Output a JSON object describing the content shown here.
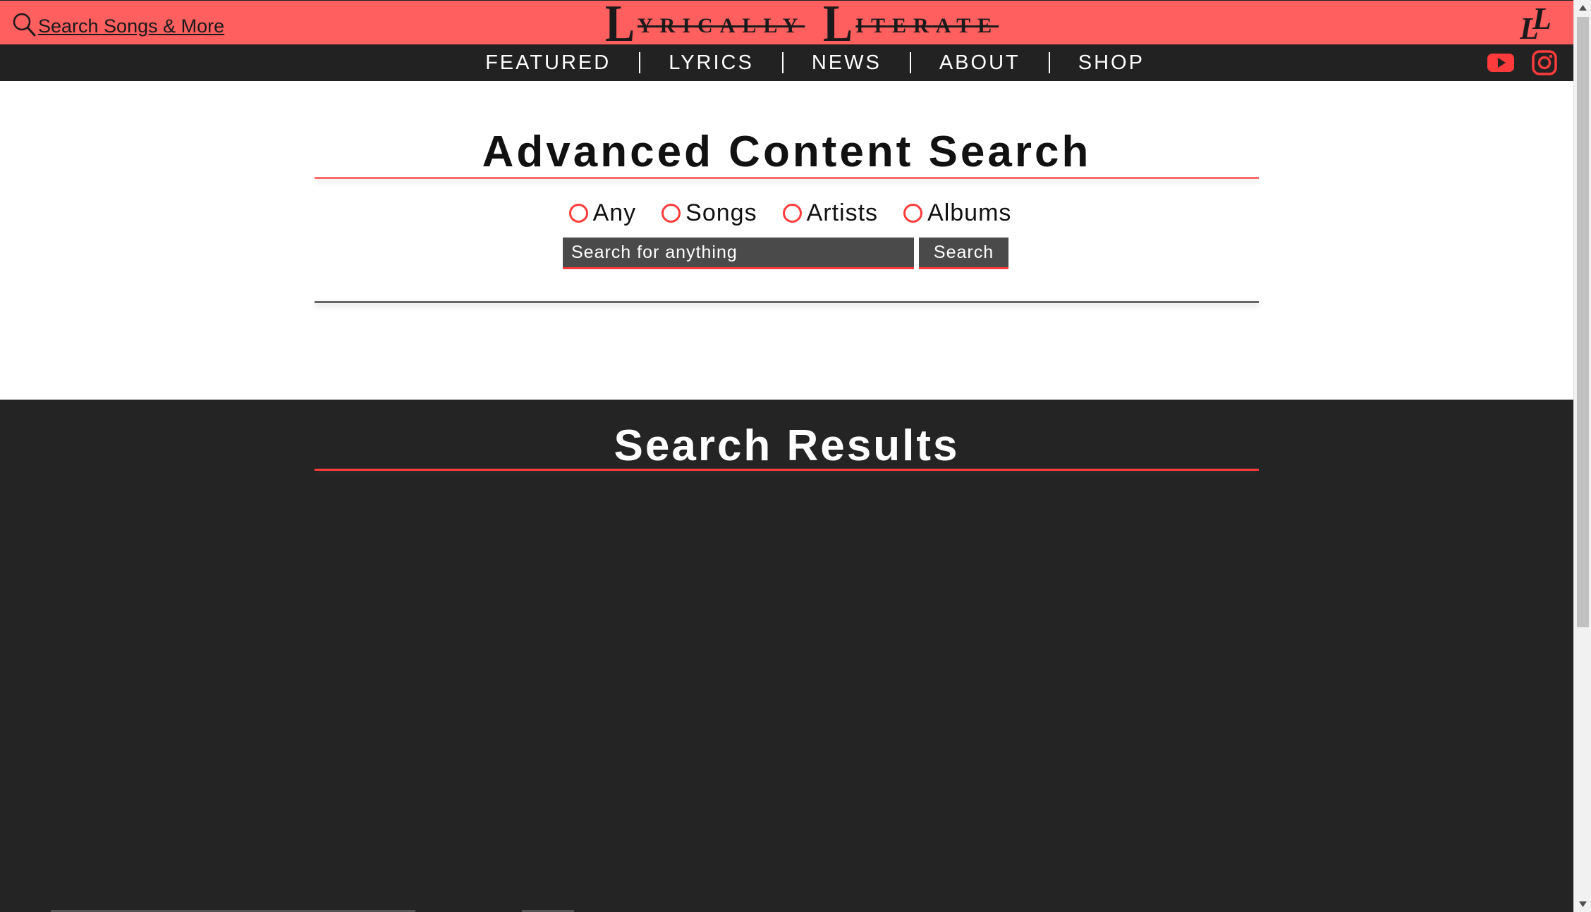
{
  "header": {
    "search_link": "Search Songs & More",
    "logo": {
      "word1_initial": "L",
      "word1_rest": "YRICALLY",
      "word2_initial": "L",
      "word2_rest": "ITERATE"
    },
    "logo_mark_icon": "ll-monogram-icon"
  },
  "nav": {
    "items": [
      {
        "label": "FEATURED"
      },
      {
        "label": "LYRICS"
      },
      {
        "label": "NEWS"
      },
      {
        "label": "ABOUT"
      },
      {
        "label": "SHOP"
      }
    ],
    "social": [
      {
        "icon": "youtube-icon"
      },
      {
        "icon": "instagram-icon"
      }
    ]
  },
  "search": {
    "title": "Advanced Content Search",
    "filters": [
      {
        "label": "Any"
      },
      {
        "label": "Songs"
      },
      {
        "label": "Artists"
      },
      {
        "label": "Albums"
      }
    ],
    "input_placeholder": "Search for anything",
    "button_label": "Search"
  },
  "results": {
    "title": "Search Results"
  },
  "colors": {
    "brand_red": "#ff5f5f",
    "accent_red": "#ff3b3b",
    "dark": "#242424",
    "input_bg": "#4a4a4a"
  }
}
